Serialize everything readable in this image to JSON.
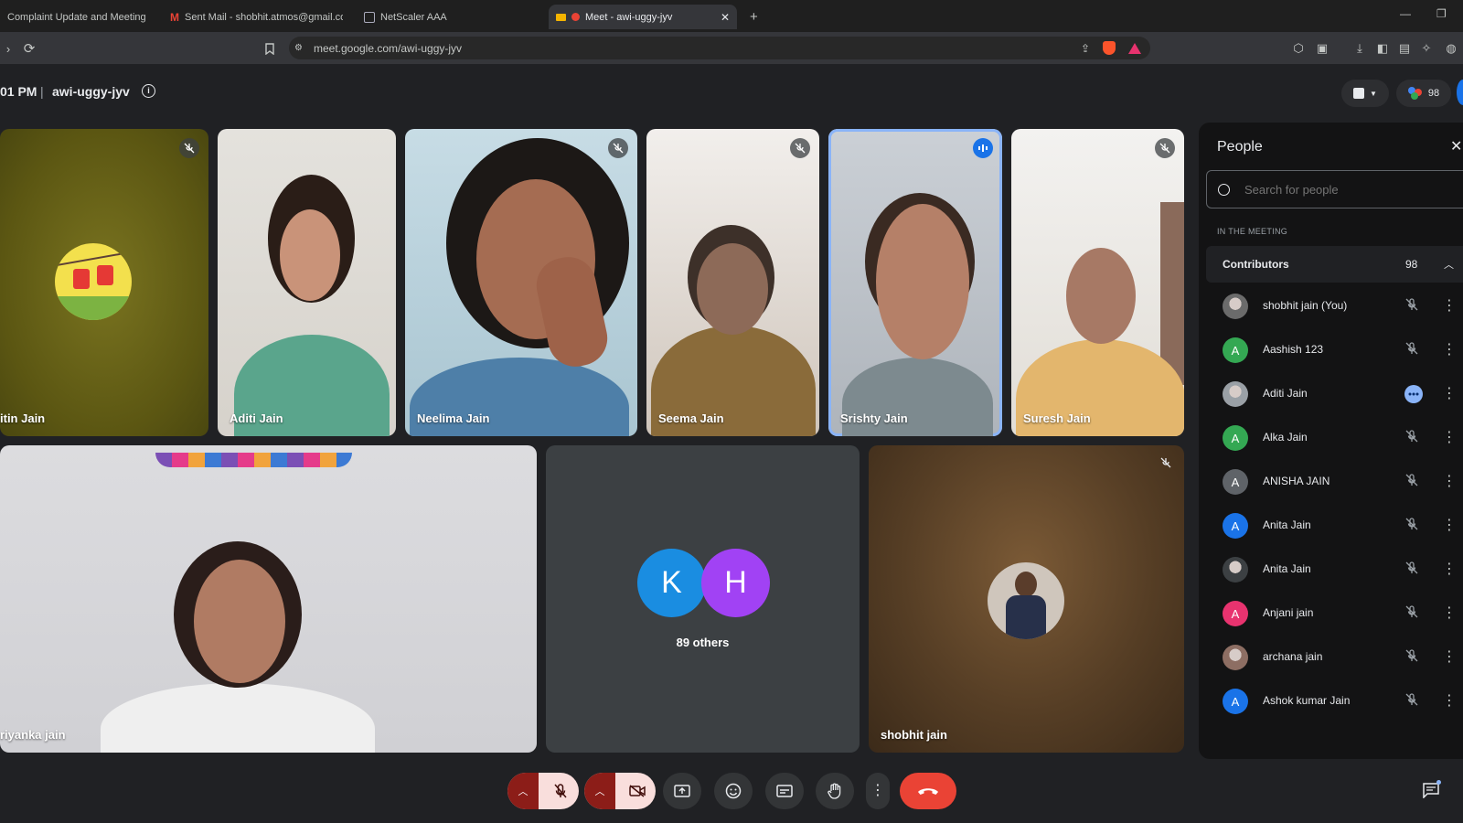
{
  "browser": {
    "tabs": [
      {
        "label": "Complaint Update and Meeting",
        "icon": "doc-icon"
      },
      {
        "label": "Sent Mail - shobhit.atmos@gmail.com",
        "icon": "gmail-icon"
      },
      {
        "label": "NetScaler AAA",
        "icon": "lock-icon"
      },
      {
        "label": "Meet - awi-uggy-jyv",
        "icon": "meet-icon"
      }
    ],
    "url": "meet.google.com/awi-uggy-jyv"
  },
  "meeting": {
    "time": "01 PM",
    "separator": "|",
    "code": "awi-uggy-jyv",
    "people_count": "98"
  },
  "tiles": {
    "nitin": {
      "name": "itin Jain"
    },
    "aditi": {
      "name": "Aditi Jain"
    },
    "neelima": {
      "name": "Neelima Jain"
    },
    "seema": {
      "name": "Seema Jain"
    },
    "srishty": {
      "name": "Srishty Jain"
    },
    "suresh": {
      "name": "Suresh Jain"
    },
    "priyanka": {
      "name": "riyanka jain"
    },
    "others": {
      "avatars": [
        "K",
        "H"
      ],
      "label": "89 others"
    },
    "shobhit": {
      "name": "shobhit jain"
    }
  },
  "people_panel": {
    "title": "People",
    "search_placeholder": "Search for people",
    "section_label": "IN THE MEETING",
    "group_label": "Contributors",
    "group_count": "98",
    "participants": [
      {
        "name": "shobhit jain (You)",
        "avatar": "",
        "avatar_color": "#6b6b6b",
        "photo": true,
        "status": "muted"
      },
      {
        "name": "Aashish 123",
        "avatar": "A",
        "avatar_color": "#34a853",
        "photo": false,
        "status": "muted"
      },
      {
        "name": "Aditi Jain",
        "avatar": "",
        "avatar_color": "#9aa0a6",
        "photo": true,
        "status": "speaking"
      },
      {
        "name": "Alka Jain",
        "avatar": "A",
        "avatar_color": "#34a853",
        "photo": false,
        "status": "muted"
      },
      {
        "name": "ANISHA JAIN",
        "avatar": "A",
        "avatar_color": "#5f6368",
        "photo": false,
        "status": "muted"
      },
      {
        "name": "Anita Jain",
        "avatar": "A",
        "avatar_color": "#1a73e8",
        "photo": false,
        "status": "muted"
      },
      {
        "name": "Anita Jain",
        "avatar": "",
        "avatar_color": "#3c4043",
        "photo": true,
        "status": "muted"
      },
      {
        "name": "Anjani jain",
        "avatar": "A",
        "avatar_color": "#e8336f",
        "photo": false,
        "status": "muted"
      },
      {
        "name": "archana jain",
        "avatar": "",
        "avatar_color": "#8d6e63",
        "photo": true,
        "status": "muted"
      },
      {
        "name": "Ashok kumar Jain",
        "avatar": "A",
        "avatar_color": "#1a73e8",
        "photo": false,
        "status": "muted"
      }
    ]
  },
  "colors": {
    "background": "#202124",
    "panel": "#131314",
    "hangup": "#ea4335",
    "muted_control": "#f9dedc",
    "muted_caret": "#8c1d18",
    "speaking_border": "#8ab4f8",
    "k_avatar": "#1a8de1",
    "h_avatar": "#a142f4"
  },
  "controls": {
    "mic": "mic-off",
    "camera": "camera-off",
    "present": "present-icon",
    "reactions": "emoji-icon",
    "captions": "captions-icon",
    "raise_hand": "hand-icon",
    "more": "more-vert-icon",
    "hangup": "hangup-icon",
    "chat": "chat-icon"
  }
}
